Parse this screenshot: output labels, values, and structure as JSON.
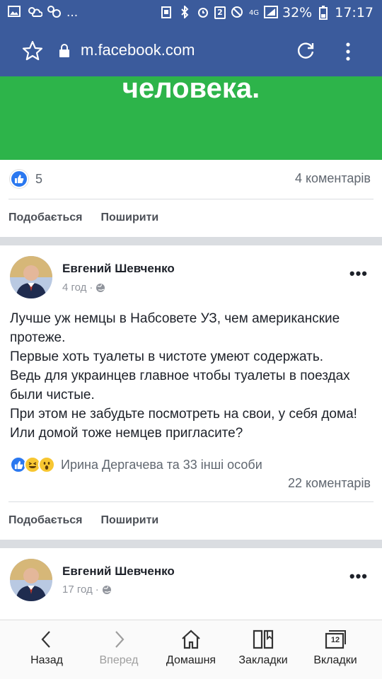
{
  "status_bar": {
    "left_icons": [
      "image-icon",
      "weather-icon",
      "notification-icon",
      "more-notifications-icon"
    ],
    "more": "...",
    "sim_badge": "2",
    "network": "4G",
    "battery": "32%",
    "time": "17:17"
  },
  "browser": {
    "url": "m.facebook.com",
    "icons": [
      "star-icon",
      "lock-icon",
      "reload-icon",
      "menu-icon"
    ]
  },
  "banner": {
    "text": "человека.",
    "color": "#2db44a"
  },
  "post1": {
    "like_count": "5",
    "comments": "4 коментарів",
    "like_label": "Подобається",
    "share_label": "Поширити"
  },
  "post2": {
    "author": "Евгений Шевченко",
    "time": "4 год",
    "dot": "·",
    "more": "•••",
    "lines": [
      "Лучше уж немцы в Набсовете УЗ, чем американские протеже.",
      "Первые хоть туалеты в чистоте умеют содержать.",
      "Ведь для украинцев главное чтобы туалеты в поездах были чистые.",
      "При этом не забудьте посмотреть на свои, у себя дома! Или домой тоже немцев пригласите?"
    ],
    "reactions": "Ирина Дергачева та 33 інші особи",
    "comments": "22 коментарів",
    "like_label": "Подобається",
    "share_label": "Поширити"
  },
  "post3": {
    "author": "Евгений Шевченко",
    "time": "17 год",
    "dot": "·",
    "more": "•••"
  },
  "bottom_nav": [
    {
      "label": "Назад",
      "icon": "back-icon"
    },
    {
      "label": "Вперед",
      "icon": "forward-icon"
    },
    {
      "label": "Домашня",
      "icon": "home-icon"
    },
    {
      "label": "Закладки",
      "icon": "bookmarks-icon"
    },
    {
      "label": "Вкладки",
      "icon": "tabs-icon",
      "count": "12"
    }
  ],
  "colors": {
    "header": "#3b5b9c",
    "like_blue": "#2a78f0",
    "banner_green": "#2db44a"
  }
}
